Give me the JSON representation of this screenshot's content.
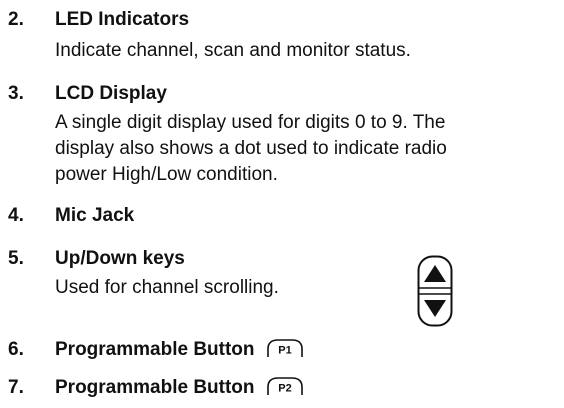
{
  "items": [
    {
      "number": "2.",
      "title": "LED Indicators",
      "description": "Indicate channel, scan and monitor status."
    },
    {
      "number": "3.",
      "title": "LCD Display",
      "description_lines": [
        "A single digit display used for digits 0 to 9. The",
        "display also shows a dot used to indicate radio",
        "power High/Low condition."
      ]
    },
    {
      "number": "4.",
      "title": "Mic Jack"
    },
    {
      "number": "5.",
      "title": "Up/Down keys",
      "description": "Used for channel scrolling."
    },
    {
      "number": "6.",
      "title": "Programmable Button",
      "badge": "P1"
    },
    {
      "number": "7.",
      "title": "Programmable Button",
      "badge": "P2"
    }
  ],
  "icons": {
    "updown_keys": "up-down-keys-icon",
    "button_badge": "programmable-button-badge-icon"
  }
}
